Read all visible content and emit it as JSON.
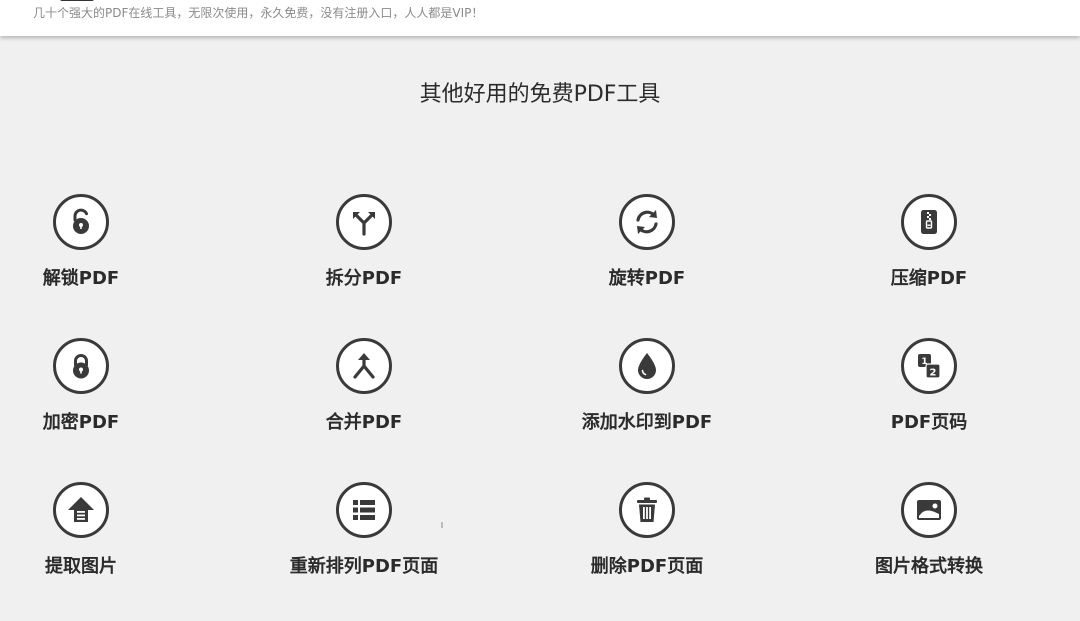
{
  "header": {
    "tagline": "几十个强大的PDF在线工具，无限次使用，永久免费，没有注册入口，人人都是VIP！"
  },
  "section": {
    "title": "其他好用的免费PDF工具"
  },
  "tools": [
    {
      "label": "解锁PDF",
      "icon": "unlock-icon"
    },
    {
      "label": "拆分PDF",
      "icon": "split-arrows-icon"
    },
    {
      "label": "旋转PDF",
      "icon": "rotate-icon"
    },
    {
      "label": "压缩PDF",
      "icon": "zip-archive-icon"
    },
    {
      "label": "加密PDF",
      "icon": "lock-icon"
    },
    {
      "label": "合并PDF",
      "icon": "merge-arrows-icon"
    },
    {
      "label": "添加水印到PDF",
      "icon": "water-drop-icon"
    },
    {
      "label": "PDF页码",
      "icon": "page-numbers-icon"
    },
    {
      "label": "提取图片",
      "icon": "extract-upload-icon"
    },
    {
      "label": "重新排列PDF页面",
      "icon": "list-reorder-icon"
    },
    {
      "label": "删除PDF页面",
      "icon": "trash-icon"
    },
    {
      "label": "图片格式转换",
      "icon": "image-icon"
    }
  ],
  "colors": {
    "background": "#f0f0f0",
    "icon": "#3a3a3a",
    "text": "#2b2b2b",
    "tagline": "#8a8a8a"
  }
}
